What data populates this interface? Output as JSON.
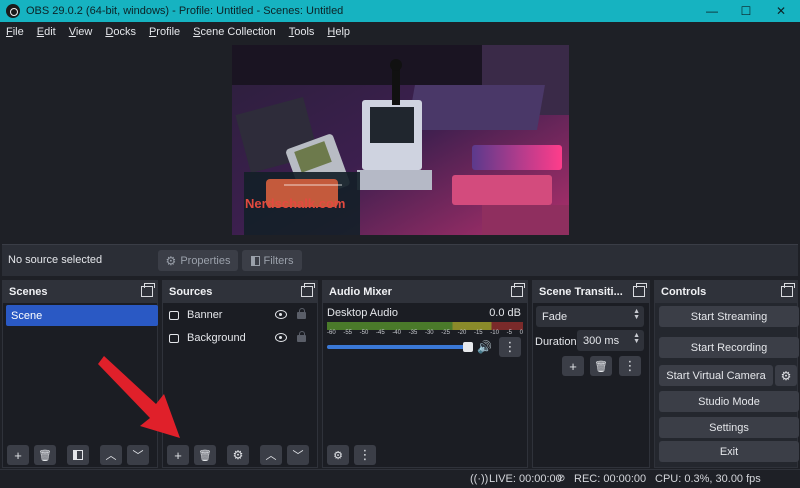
{
  "window": {
    "title": "OBS 29.0.2 (64-bit, windows) - Profile: Untitled - Scenes: Untitled",
    "minimize": "—",
    "maximize": "☐",
    "close": "✕"
  },
  "menu": [
    {
      "label": "File"
    },
    {
      "label": "Edit"
    },
    {
      "label": "View"
    },
    {
      "label": "Docks"
    },
    {
      "label": "Profile"
    },
    {
      "label": "Scene Collection"
    },
    {
      "label": "Tools"
    },
    {
      "label": "Help"
    }
  ],
  "preview": {
    "watermark": "Nerdschalk.com"
  },
  "source_bar": {
    "status": "No source selected",
    "properties": "Properties",
    "filters": "Filters"
  },
  "scenes": {
    "title": "Scenes",
    "items": [
      "Scene"
    ]
  },
  "sources": {
    "title": "Sources",
    "items": [
      "Banner",
      "Background"
    ]
  },
  "audio_mixer": {
    "title": "Audio Mixer",
    "track_name": "Desktop Audio",
    "level": "0.0 dB",
    "volume": 1.0,
    "scale": [
      "-60",
      "-55",
      "-50",
      "-45",
      "-40",
      "-35",
      "-30",
      "-25",
      "-20",
      "-15",
      "-10",
      "-5",
      "0"
    ]
  },
  "transitions": {
    "title": "Scene Transiti...",
    "type": "Fade",
    "duration_label": "Duration",
    "duration": "300 ms"
  },
  "controls": {
    "title": "Controls",
    "start_streaming": "Start Streaming",
    "start_recording": "Start Recording",
    "start_virtual_camera": "Start Virtual Camera",
    "studio_mode": "Studio Mode",
    "settings": "Settings",
    "exit": "Exit"
  },
  "status": {
    "live": "LIVE: 00:00:00",
    "rec": "REC: 00:00:00",
    "cpu": "CPU: 0.3%, 30.00 fps"
  },
  "colors": {
    "titlebar": "#16b3c1",
    "accent_selected": "#2a59c4",
    "annotation_arrow": "#e0202a"
  }
}
